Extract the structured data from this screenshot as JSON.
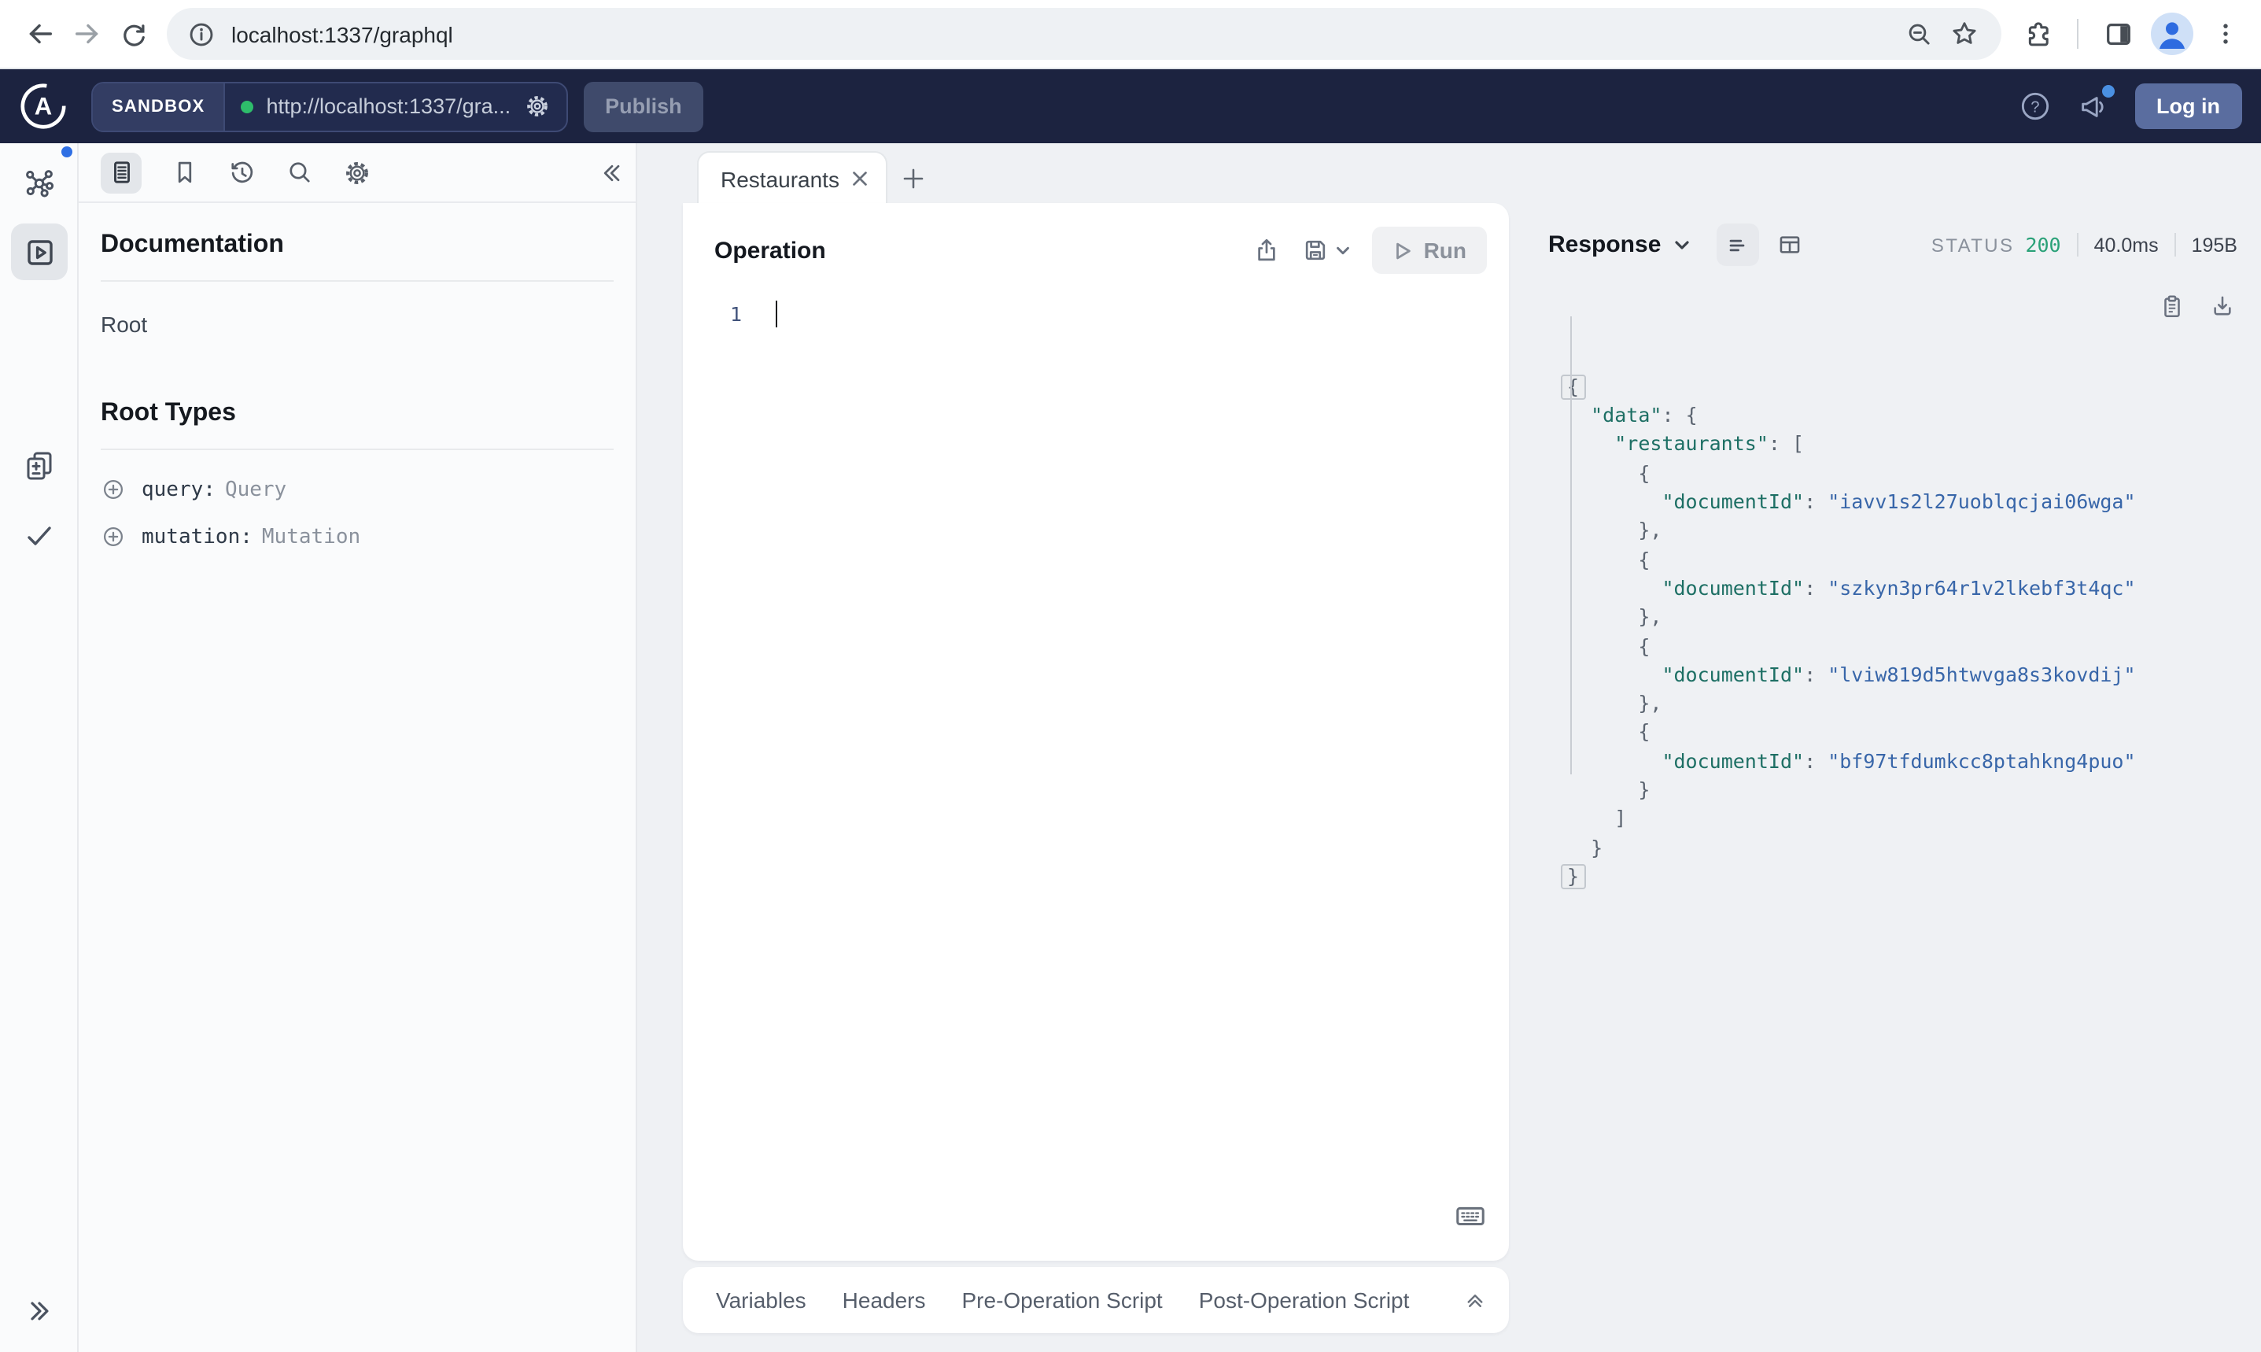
{
  "colors": {
    "header_bg": "#1c2340",
    "status_green": "#2aa178",
    "json_key_teal": "#1d6f64",
    "json_string_blue": "#3866a9",
    "accent_blue": "#2f6fe4"
  },
  "browser": {
    "url": "localhost:1337/graphql",
    "icons": [
      "back-icon",
      "forward-icon",
      "reload-icon",
      "info-icon",
      "zoom-out-icon",
      "star-icon",
      "extensions-icon",
      "side-panel-icon",
      "profile-avatar",
      "menu-kebab-icon"
    ]
  },
  "header": {
    "brand_chip": "SANDBOX",
    "endpoint": "http://localhost:1337/gra...",
    "publish_label": "Publish",
    "login_label": "Log in",
    "icons": [
      "apollo-logo",
      "status-dot",
      "gear-icon",
      "help-icon",
      "megaphone-icon"
    ]
  },
  "rail": {
    "icons": [
      "schema-graph-icon",
      "explorer-icon",
      "diff-icon",
      "checklist-icon",
      "expand-right-icon"
    ]
  },
  "docs": {
    "title": "Documentation",
    "root_label": "Root",
    "root_types_title": "Root Types",
    "types": [
      {
        "field": "query:",
        "type": "Query"
      },
      {
        "field": "mutation:",
        "type": "Mutation"
      }
    ],
    "toolbar_icons": [
      "document-icon",
      "bookmark-icon",
      "history-icon",
      "search-icon",
      "gear-icon",
      "collapse-left-icon"
    ]
  },
  "tabs": {
    "active_tab": "Restaurants"
  },
  "operation": {
    "title": "Operation",
    "run_label": "Run",
    "line_number": "1",
    "icons": [
      "share-icon",
      "save-icon",
      "chevron-down-icon",
      "play-icon",
      "keyboard-icon"
    ]
  },
  "response": {
    "title": "Response",
    "status_label": "STATUS",
    "status_code": "200",
    "time": "40.0ms",
    "size": "195B",
    "icons": [
      "chevron-down-icon",
      "format-lines-icon",
      "table-view-icon",
      "copy-icon",
      "download-icon"
    ],
    "body": {
      "data": {
        "restaurants": [
          {
            "documentId": "iavv1s2l27uoblqcjai06wga"
          },
          {
            "documentId": "szkyn3pr64r1v2lkebf3t4qc"
          },
          {
            "documentId": "lviw819d5htwvga8s3kovdij"
          },
          {
            "documentId": "bf97tfdumkcc8ptahkng4puo"
          }
        ]
      }
    }
  },
  "bottom_tabs": [
    "Variables",
    "Headers",
    "Pre-Operation Script",
    "Post-Operation Script"
  ]
}
